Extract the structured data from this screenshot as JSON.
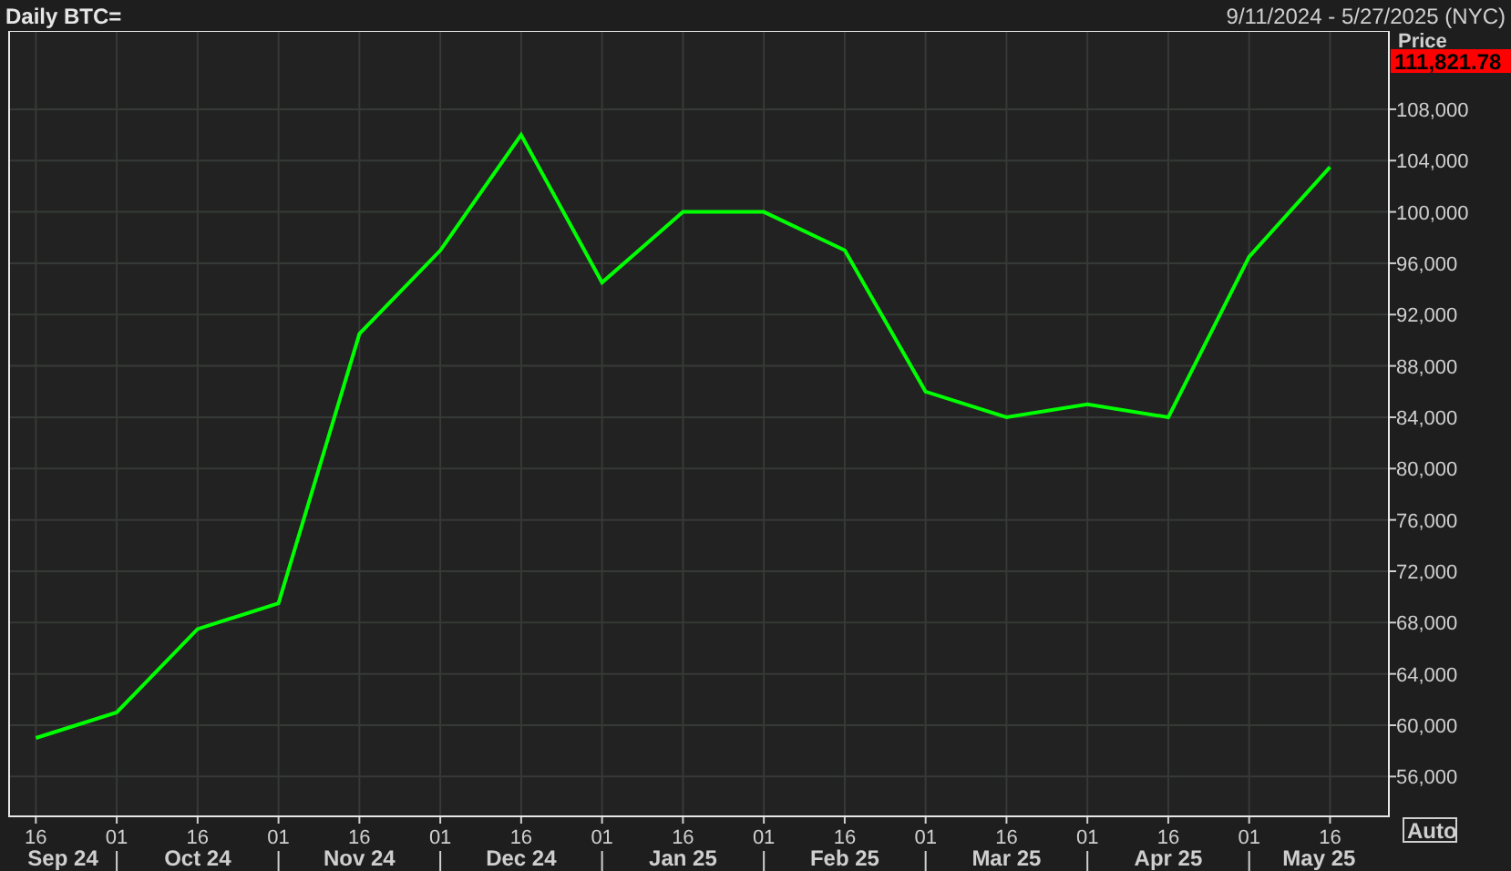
{
  "header": {
    "title": "Daily BTC=",
    "date_range": "9/11/2024 - 5/27/2025 (NYC)"
  },
  "axis": {
    "title": "Price",
    "last_price": "111,821.78",
    "scale_button": "Auto"
  },
  "month_labels": [
    "Sep 24",
    "Oct 24",
    "Nov 24",
    "Dec 24",
    "Jan 25",
    "Feb 25",
    "Mar 25",
    "Apr 25",
    "May 25"
  ],
  "chart_data": {
    "type": "line",
    "categories": [
      "16",
      "01",
      "16",
      "01",
      "16",
      "01",
      "16",
      "01",
      "16",
      "01",
      "16",
      "01",
      "16",
      "01",
      "16",
      "01",
      "16"
    ],
    "series": [
      {
        "color": "#00ff00",
        "values": [
          59000,
          61000,
          67500,
          69500,
          90500,
          97000,
          106000,
          94500,
          100000,
          100000,
          97000,
          86000,
          84000,
          85000,
          84000,
          96500,
          103500
        ]
      }
    ],
    "grid": true,
    "ylim": [
      52900,
      114100
    ],
    "yticks": [
      {
        "value": 56000,
        "label": "56,000"
      },
      {
        "value": 60000,
        "label": "60,000"
      },
      {
        "value": 64000,
        "label": "64,000"
      },
      {
        "value": 68000,
        "label": "68,000"
      },
      {
        "value": 72000,
        "label": "72,000"
      },
      {
        "value": 76000,
        "label": "76,000"
      },
      {
        "value": 80000,
        "label": "80,000"
      },
      {
        "value": 84000,
        "label": "84,000"
      },
      {
        "value": 88000,
        "label": "88,000"
      },
      {
        "value": 92000,
        "label": "92,000"
      },
      {
        "value": 96000,
        "label": "96,000"
      },
      {
        "value": 100000,
        "label": "100,000"
      },
      {
        "value": 104000,
        "label": "104,000"
      },
      {
        "value": 108000,
        "label": "108,000"
      }
    ]
  }
}
